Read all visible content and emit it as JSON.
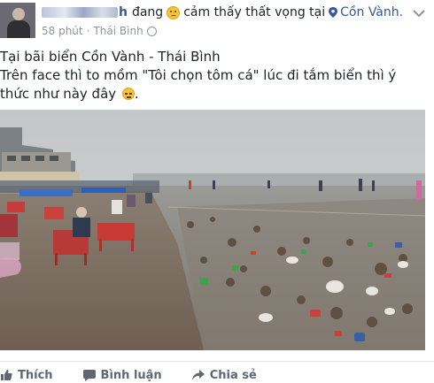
{
  "post": {
    "author_tail": "h",
    "feeling_text": "đang",
    "feeling_label": "cảm thấy thất vọng tại",
    "location": "Cồn Vành.",
    "time": "58 phút",
    "place_meta": "Thái Bình",
    "separator": "·",
    "headline": "Tại bãi biển Cồn Vành - Thái Bình",
    "body": "Trên face thì to mồm \"Tôi chọn tôm cá\" lúc đi tắm biển thì ý thức như này đây",
    "body_end": "."
  },
  "icons": {
    "feeling": "disappointed-emoji-icon",
    "location": "location-pin-icon",
    "privacy": "globe-icon",
    "menu": "chevron-down-icon",
    "body_emoji": "sad-face-emoji-icon",
    "like": "thumbs-up-icon",
    "comment": "comment-icon",
    "share": "share-icon"
  },
  "actions": {
    "like": "Thích",
    "comment": "Bình luận",
    "share": "Chia sẻ"
  },
  "colors": {
    "link": "#365899",
    "meta": "#90949c",
    "action": "#606770"
  }
}
